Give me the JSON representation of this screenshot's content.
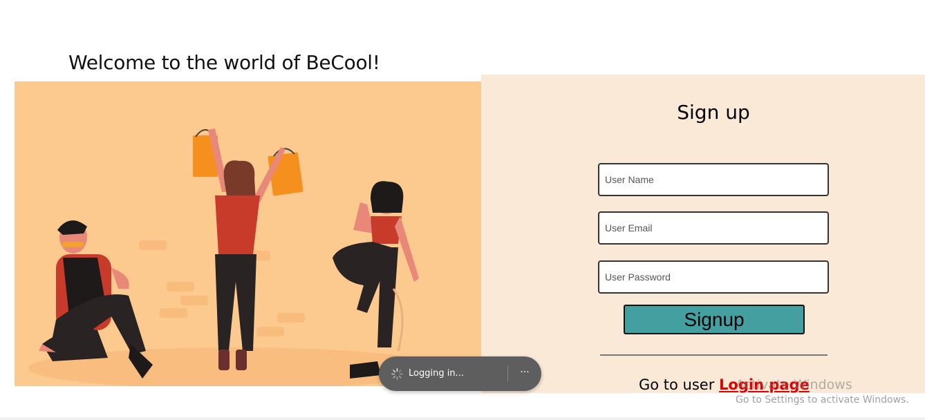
{
  "welcome": {
    "title": "Welcome to the world of BeCool!"
  },
  "signup": {
    "heading": "Sign up",
    "fields": {
      "name_placeholder": "User Name",
      "email_placeholder": "User Email",
      "password_placeholder": "User Password"
    },
    "button_label": "Signup",
    "goto_prefix": "Go to user ",
    "login_link": "Login page"
  },
  "toast": {
    "message": "Logging in...",
    "more_label": "···"
  },
  "watermark": {
    "line1": "Activate Windows",
    "line2": "Go to Settings to activate Windows."
  },
  "colors": {
    "hero_bg": "#fcc98e",
    "panel_bg": "#f9e9d6",
    "button_bg": "#44a0a0",
    "link": "#e00000"
  }
}
